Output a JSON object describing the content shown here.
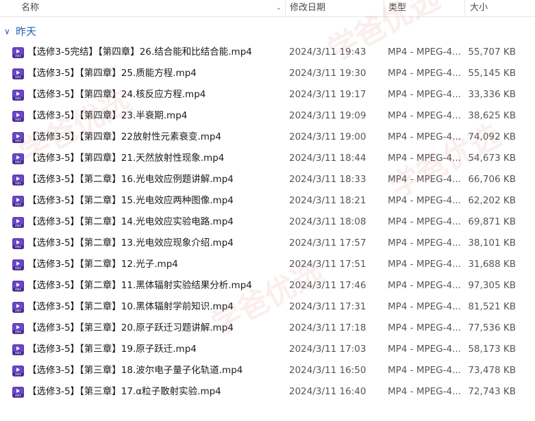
{
  "columns": {
    "name": "名称",
    "date": "修改日期",
    "type": "类型",
    "size": "大小"
  },
  "group": {
    "label": "昨天"
  },
  "icon": "video-file-icon",
  "watermark_text": "学爸优选",
  "files": [
    {
      "name": "【选修3-5完结】【第四章】26.结合能和比结合能.mp4",
      "date": "2024/3/11 19:43",
      "type": "MP4 - MPEG-4...",
      "size": "55,707 KB"
    },
    {
      "name": "【选修3-5】【第四章】25.质能方程.mp4",
      "date": "2024/3/11 19:30",
      "type": "MP4 - MPEG-4...",
      "size": "55,145 KB"
    },
    {
      "name": "【选修3-5】【第四章】24.核反应方程.mp4",
      "date": "2024/3/11 19:17",
      "type": "MP4 - MPEG-4...",
      "size": "33,336 KB"
    },
    {
      "name": "【选修3-5】【第四章】23.半衰期.mp4",
      "date": "2024/3/11 19:09",
      "type": "MP4 - MPEG-4...",
      "size": "38,625 KB"
    },
    {
      "name": "【选修3-5】【第四章】22放射性元素衰变.mp4",
      "date": "2024/3/11 19:00",
      "type": "MP4 - MPEG-4...",
      "size": "74,092 KB"
    },
    {
      "name": "【选修3-5】【第四章】21.天然放射性现象.mp4",
      "date": "2024/3/11 18:44",
      "type": "MP4 - MPEG-4...",
      "size": "54,673 KB"
    },
    {
      "name": "【选修3-5】【第二章】16.光电效应例题讲解.mp4",
      "date": "2024/3/11 18:33",
      "type": "MP4 - MPEG-4...",
      "size": "66,706 KB"
    },
    {
      "name": "【选修3-5】【第二章】15.光电效应两种图像.mp4",
      "date": "2024/3/11 18:21",
      "type": "MP4 - MPEG-4...",
      "size": "62,202 KB"
    },
    {
      "name": "【选修3-5】【第二章】14.光电效应实验电路.mp4",
      "date": "2024/3/11 18:08",
      "type": "MP4 - MPEG-4...",
      "size": "69,871 KB"
    },
    {
      "name": "【选修3-5】【第二章】13.光电效应现象介绍.mp4",
      "date": "2024/3/11 17:57",
      "type": "MP4 - MPEG-4...",
      "size": "38,101 KB"
    },
    {
      "name": "【选修3-5】【第二章】12.光子.mp4",
      "date": "2024/3/11 17:51",
      "type": "MP4 - MPEG-4...",
      "size": "31,688 KB"
    },
    {
      "name": "【选修3-5】【第二章】11.黑体辐射实验结果分析.mp4",
      "date": "2024/3/11 17:46",
      "type": "MP4 - MPEG-4...",
      "size": "97,305 KB"
    },
    {
      "name": "【选修3-5】【第二章】10.黑体辐射学前知识.mp4",
      "date": "2024/3/11 17:31",
      "type": "MP4 - MPEG-4...",
      "size": "81,521 KB"
    },
    {
      "name": "【选修3-5】【第三章】20.原子跃迁习题讲解.mp4",
      "date": "2024/3/11 17:18",
      "type": "MP4 - MPEG-4...",
      "size": "77,536 KB"
    },
    {
      "name": "【选修3-5】【第三章】19.原子跃迁.mp4",
      "date": "2024/3/11 17:03",
      "type": "MP4 - MPEG-4...",
      "size": "58,173 KB"
    },
    {
      "name": "【选修3-5】【第三章】18.波尔电子量子化轨道.mp4",
      "date": "2024/3/11 16:50",
      "type": "MP4 - MPEG-4...",
      "size": "73,478 KB"
    },
    {
      "name": "【选修3-5】【第三章】17.α粒子散射实验.mp4",
      "date": "2024/3/11 16:40",
      "type": "MP4 - MPEG-4...",
      "size": "72,743 KB"
    }
  ]
}
